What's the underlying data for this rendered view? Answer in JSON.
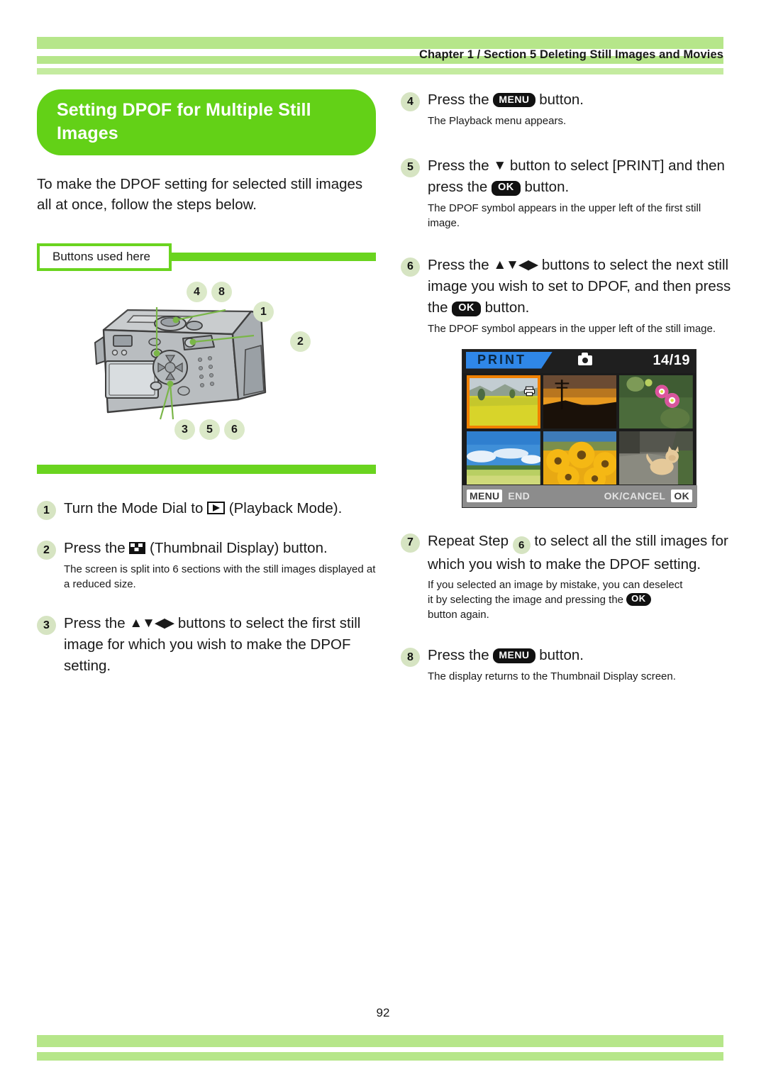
{
  "header": {
    "breadcrumb": "Chapter  1 / Section 5  Deleting Still Images and Movies"
  },
  "section": {
    "title": "Setting DPOF for Multiple Still Images",
    "intro": "To make the DPOF setting for selected still images all at once, follow the steps below.",
    "buttons_used_label": "Buttons used here"
  },
  "diagram": {
    "name": "camera-rear-illustration",
    "callouts": [
      "4",
      "8",
      "1",
      "2",
      "3",
      "5",
      "6"
    ]
  },
  "steps": {
    "s1": {
      "num": "1",
      "text_before": "Turn the Mode Dial to",
      "icon": "playback-mode-icon",
      "text_after": "(Playback Mode)."
    },
    "s2": {
      "num": "2",
      "text_before": "Press the",
      "icon": "thumbnail-display-icon",
      "text_after": "(Thumbnail Display) button.",
      "sub": "The screen is split into 6 sections with the still images displayed at a reduced size."
    },
    "s3": {
      "num": "3",
      "text_before": "Press the",
      "arrows": "▲▼◀▶",
      "text_after": "buttons to select the first still image for which you wish to make the DPOF setting."
    },
    "s4": {
      "num": "4",
      "text_before": "Press the",
      "key": "MENU",
      "text_after": "button.",
      "sub": "The Playback menu appears."
    },
    "s5": {
      "num": "5",
      "text_before": "Press the",
      "arrow_down": "▼",
      "text_mid": "button to select [PRINT] and then press the",
      "key": "OK",
      "text_after": "button.",
      "sub": "The DPOF symbol appears in the upper left of the first still image."
    },
    "s6": {
      "num": "6",
      "text_before": "Press the",
      "arrows": "▲▼◀▶",
      "text_mid": "buttons to select the next still image you wish to set to DPOF, and then press the",
      "key": "OK",
      "text_after": "button.",
      "sub": "The DPOF symbol appears in the upper left of the still image."
    },
    "s7": {
      "num": "7",
      "text_before": "Repeat Step",
      "ref_num": "6",
      "text_after": "to select all the still images for which you wish to make the DPOF setting.",
      "sub_a": "If you selected an image by mistake, you can deselect",
      "sub_b": "it by selecting the image and pressing the",
      "key": "OK",
      "sub_c": "button again."
    },
    "s8": {
      "num": "8",
      "text_before": "Press the",
      "key": "MENU",
      "text_after": "button.",
      "sub": "The display returns to the Thumbnail Display screen."
    }
  },
  "lcd": {
    "mode_label": "PRINT",
    "camera_icon": "camera-icon",
    "counter": "14/19",
    "thumbnails": [
      {
        "name": "thumb-canola-field",
        "selected": true,
        "dpof": true
      },
      {
        "name": "thumb-sunset-pole",
        "selected": false,
        "dpof": false
      },
      {
        "name": "thumb-pink-flower",
        "selected": false,
        "dpof": false
      },
      {
        "name": "thumb-blue-sky-field",
        "selected": false,
        "dpof": false
      },
      {
        "name": "thumb-sunflowers",
        "selected": false,
        "dpof": false
      },
      {
        "name": "thumb-cat-on-path",
        "selected": false,
        "dpof": false
      }
    ],
    "bottom_left_key": "MENU",
    "bottom_left_label": "END",
    "bottom_right_label": "OK/CANCEL",
    "bottom_right_key": "OK"
  },
  "footer": {
    "page_number": "92"
  },
  "colors": {
    "header_bar": "#b6e68a",
    "title_pill": "#63d117",
    "rule_green": "#6ad41f",
    "step_circle": "#d6e4c2",
    "lcd_selection": "#f08000",
    "lcd_banner": "#2f87e8"
  }
}
